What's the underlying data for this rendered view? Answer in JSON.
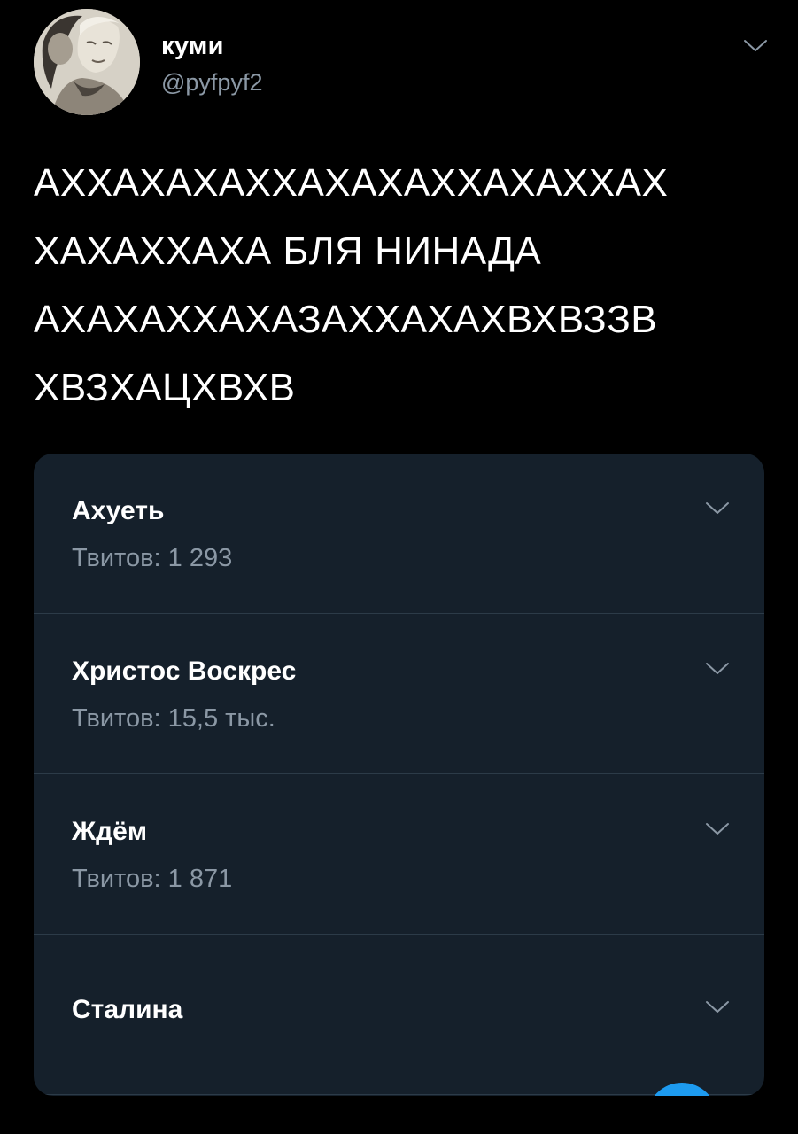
{
  "user": {
    "name": "куми",
    "handle": "@pyfpyf2",
    "avatar_icon": "avatar-photo"
  },
  "header": {
    "more_icon": "chevron-down-icon"
  },
  "tweet": {
    "lines": [
      "АХХАХАХАХХАХАХАХХАХАХХАХ",
      "ХАХАХХАХА БЛЯ НИНАДА",
      "АХАХАХХАХАЗАХХАХАХВХВЗЗВ",
      "ХВЗХАЦХВХВ"
    ]
  },
  "poll": {
    "options": [
      {
        "title": "Ахуеть",
        "count": "Твитов: 1 293"
      },
      {
        "title": "Христос Воскрес",
        "count": "Твитов: 15,5 тыс."
      },
      {
        "title": "Ждём",
        "count": "Твитов: 1 871"
      },
      {
        "title": "Сталина",
        "count": ""
      }
    ]
  },
  "colors": {
    "background": "#000000",
    "card": "#15202b",
    "secondary_text": "#8b98a5",
    "divider": "#2c3b48",
    "accent": "#1d9bf0"
  }
}
